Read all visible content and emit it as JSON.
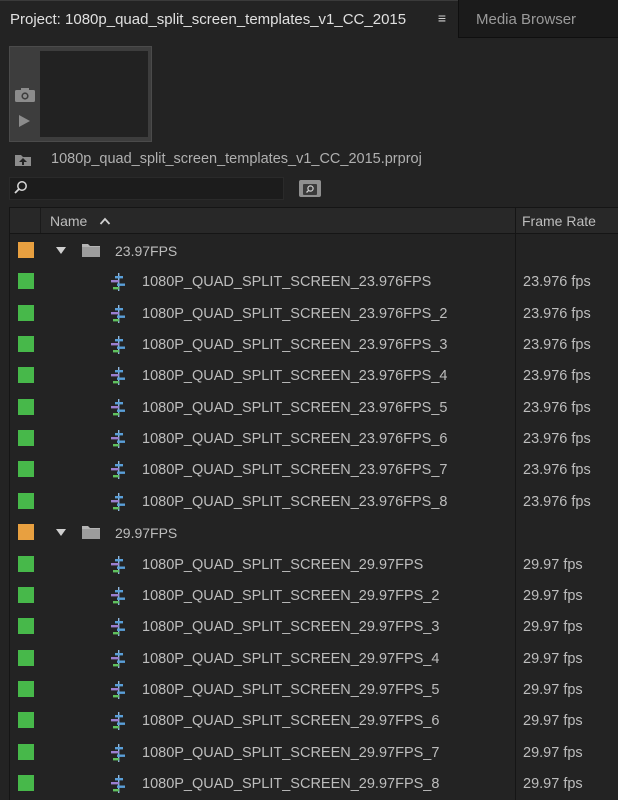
{
  "tabs": {
    "project_label": "Project: 1080p_quad_split_screen_templates_v1_CC_2015",
    "menu_glyph": "≡",
    "media_browser_label": "Media Browser"
  },
  "project_path": "1080p_quad_split_screen_templates_v1_CC_2015.prproj",
  "search": {
    "value": "",
    "placeholder": ""
  },
  "columns": {
    "name": "Name",
    "frame_rate": "Frame Rate"
  },
  "colors": {
    "bin_label": "#e8a040",
    "sequence_label": "#47b84a",
    "sequence_icon_accent": "#4a9ad8"
  },
  "icons": {
    "preview_capture": "camera-icon",
    "preview_play": "play-icon",
    "navigate_up": "folder-up-icon",
    "search": "search-icon",
    "find": "find-icon",
    "sort": "sort-ascending-icon",
    "bin": "folder-icon",
    "sequence": "sequence-icon"
  },
  "bins": [
    {
      "name": "23.97FPS",
      "expanded": true,
      "items": [
        {
          "name": "1080P_QUAD_SPLIT_SCREEN_23.976FPS",
          "frame_rate": "23.976 fps"
        },
        {
          "name": "1080P_QUAD_SPLIT_SCREEN_23.976FPS_2",
          "frame_rate": "23.976 fps"
        },
        {
          "name": "1080P_QUAD_SPLIT_SCREEN_23.976FPS_3",
          "frame_rate": "23.976 fps"
        },
        {
          "name": "1080P_QUAD_SPLIT_SCREEN_23.976FPS_4",
          "frame_rate": "23.976 fps"
        },
        {
          "name": "1080P_QUAD_SPLIT_SCREEN_23.976FPS_5",
          "frame_rate": "23.976 fps"
        },
        {
          "name": "1080P_QUAD_SPLIT_SCREEN_23.976FPS_6",
          "frame_rate": "23.976 fps"
        },
        {
          "name": "1080P_QUAD_SPLIT_SCREEN_23.976FPS_7",
          "frame_rate": "23.976 fps"
        },
        {
          "name": "1080P_QUAD_SPLIT_SCREEN_23.976FPS_8",
          "frame_rate": "23.976 fps"
        }
      ]
    },
    {
      "name": "29.97FPS",
      "expanded": true,
      "items": [
        {
          "name": "1080P_QUAD_SPLIT_SCREEN_29.97FPS",
          "frame_rate": "29.97 fps"
        },
        {
          "name": "1080P_QUAD_SPLIT_SCREEN_29.97FPS_2",
          "frame_rate": "29.97 fps"
        },
        {
          "name": "1080P_QUAD_SPLIT_SCREEN_29.97FPS_3",
          "frame_rate": "29.97 fps"
        },
        {
          "name": "1080P_QUAD_SPLIT_SCREEN_29.97FPS_4",
          "frame_rate": "29.97 fps"
        },
        {
          "name": "1080P_QUAD_SPLIT_SCREEN_29.97FPS_5",
          "frame_rate": "29.97 fps"
        },
        {
          "name": "1080P_QUAD_SPLIT_SCREEN_29.97FPS_6",
          "frame_rate": "29.97 fps"
        },
        {
          "name": "1080P_QUAD_SPLIT_SCREEN_29.97FPS_7",
          "frame_rate": "29.97 fps"
        },
        {
          "name": "1080P_QUAD_SPLIT_SCREEN_29.97FPS_8",
          "frame_rate": "29.97 fps"
        }
      ]
    }
  ]
}
